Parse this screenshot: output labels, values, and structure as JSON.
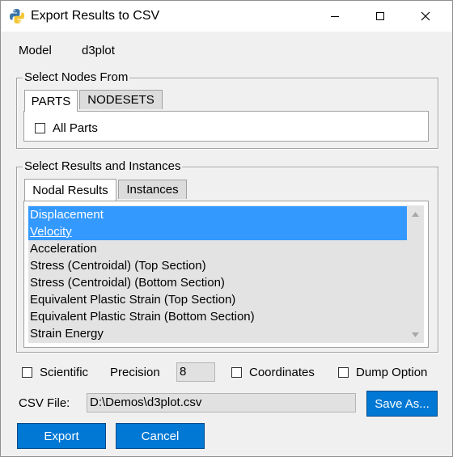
{
  "window": {
    "title": "Export Results to CSV"
  },
  "model": {
    "label": "Model",
    "value": "d3plot"
  },
  "nodes_group": {
    "title": "Select Nodes From",
    "tabs": [
      "PARTS",
      "NODESETS"
    ],
    "all_parts_label": "All Parts"
  },
  "results_group": {
    "title": "Select Results and Instances",
    "tabs": [
      "Nodal Results",
      "Instances"
    ],
    "items": [
      "Displacement",
      "Velocity",
      "Acceleration",
      "Stress (Centroidal) (Top Section)",
      "Stress (Centroidal) (Bottom Section)",
      "Equivalent Plastic Strain (Top Section)",
      "Equivalent Plastic Strain (Bottom Section)",
      "Strain Energy"
    ],
    "selected": [
      "Displacement",
      "Velocity"
    ]
  },
  "options": {
    "scientific_label": "Scientific",
    "precision_label": "Precision",
    "precision_value": "8",
    "coordinates_label": "Coordinates",
    "dump_label": "Dump Option"
  },
  "csv": {
    "label": "CSV File:",
    "path": "D:\\Demos\\d3plot.csv",
    "save_as_label": "Save As..."
  },
  "buttons": {
    "export_label": "Export",
    "cancel_label": "Cancel"
  },
  "colors": {
    "accent": "#0078d4",
    "selection": "#3399ff",
    "list_bg": "#e3e3e3"
  }
}
